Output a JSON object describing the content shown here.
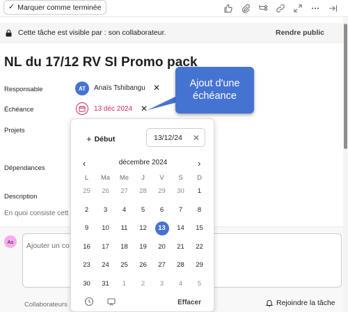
{
  "toolbar": {
    "mark_complete_label": "Marquer comme terminée",
    "icons": [
      "thumbs-up-icon",
      "paperclip-icon",
      "subtask-icon",
      "link-icon",
      "expand-icon",
      "more-icon",
      "close-arrow-icon"
    ]
  },
  "visibility": {
    "text": "Cette tâche est visible par : son collaborateur.",
    "make_public": "Rendre public"
  },
  "task": {
    "title": "NL du 17/12 RV SI Promo pack"
  },
  "fields": {
    "assignee_label": "Responsable",
    "assignee_initials": "AT",
    "assignee_name": "Anaïs Tshibangu",
    "due_label": "Échéance",
    "due_date": "13 déc 2024",
    "projects_label": "Projets",
    "dependencies_label": "Dépendances",
    "description_label": "Description",
    "description_placeholder": "En quoi consiste cett"
  },
  "tooltip": {
    "line1": "Ajout d'une",
    "line2": "échéance"
  },
  "datepicker": {
    "start_label": "Début",
    "date_value": "13/12/24",
    "month_label": "décembre 2024",
    "weekdays": [
      "L",
      "Ma",
      "Me",
      "J",
      "V",
      "S",
      "D"
    ],
    "weeks": [
      [
        "25",
        "26",
        "27",
        "28",
        "29",
        "30",
        "1"
      ],
      [
        "2",
        "3",
        "4",
        "5",
        "6",
        "7",
        "8"
      ],
      [
        "9",
        "10",
        "11",
        "12",
        "13",
        "14",
        "15"
      ],
      [
        "16",
        "17",
        "18",
        "19",
        "20",
        "21",
        "22"
      ],
      [
        "23",
        "24",
        "25",
        "26",
        "27",
        "28",
        "29"
      ],
      [
        "30",
        "31",
        "1",
        "2",
        "3",
        "4",
        "5"
      ]
    ],
    "selected_day": "13",
    "clear_label": "Effacer"
  },
  "comments": {
    "avatar_initials": "As",
    "placeholder": "Ajouter un co",
    "collaborators_label": "Collaborateurs",
    "join_label": "Rejoindre la tâche"
  },
  "colors": {
    "accent": "#4573d2",
    "overdue": "#c92f54",
    "comment_avatar": "#f9aaef"
  }
}
